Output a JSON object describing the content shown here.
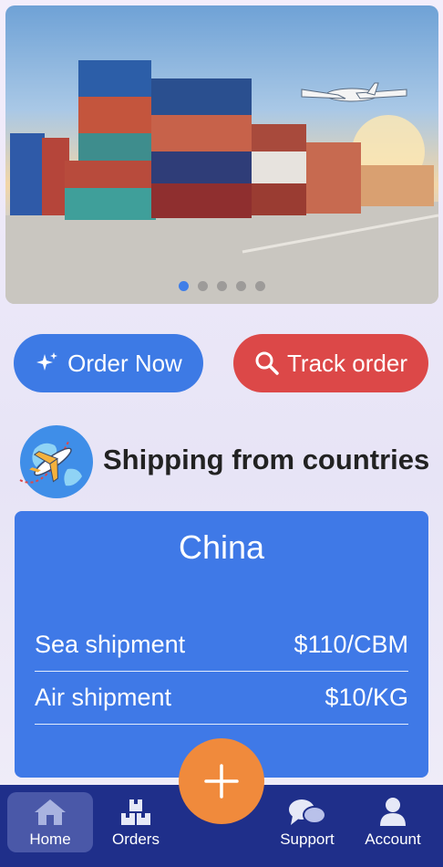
{
  "hero": {
    "slide_count": 5,
    "active_slide": 1
  },
  "actions": {
    "order_label": "Order Now",
    "track_label": "Track order",
    "order_color": "#3d7ae5",
    "track_color": "#dc4848"
  },
  "section": {
    "title": "Shipping from countries"
  },
  "country_card": {
    "country": "China",
    "rates": [
      {
        "label": "Sea shipment",
        "value": "$110/CBM"
      },
      {
        "label": "Air shipment",
        "value": "$10/KG"
      }
    ]
  },
  "nav": {
    "items": [
      {
        "label": "Home",
        "icon": "home-icon",
        "active": true
      },
      {
        "label": "Orders",
        "icon": "boxes-icon",
        "active": false
      },
      {
        "label": "Support",
        "icon": "chat-icon",
        "active": false
      },
      {
        "label": "Account",
        "icon": "user-icon",
        "active": false
      }
    ],
    "fab_icon": "plus-icon",
    "fab_color": "#f08a3c",
    "bar_color": "#1f2f8a"
  }
}
